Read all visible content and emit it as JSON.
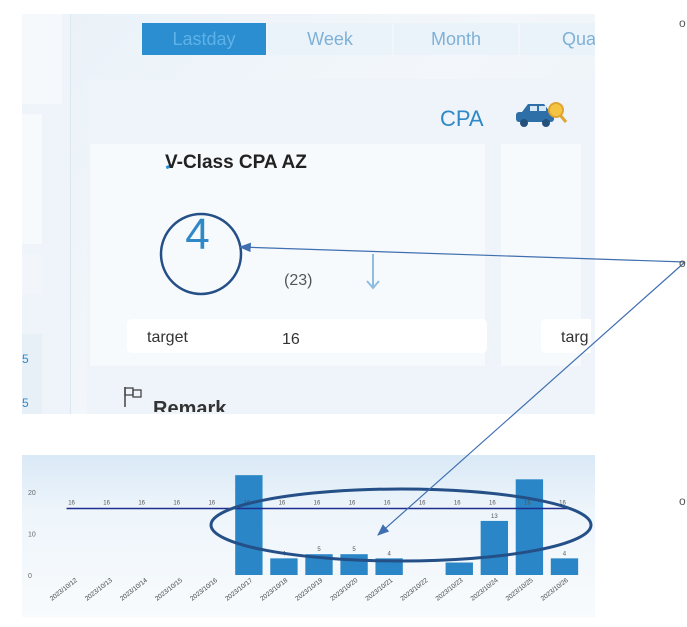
{
  "tabs": [
    "Lastday",
    "Week",
    "Month",
    "Quar"
  ],
  "active_tab": 0,
  "section_title": "CPA",
  "card": {
    "title": "V-Class CPA AZ",
    "value": "4",
    "comparison": "(23)",
    "target_label": "target",
    "target_value": "16",
    "second_card_target_label": "targ"
  },
  "remark_label": "Remark",
  "left_strip_marks": [
    "5",
    "5"
  ],
  "side_markers": [
    "o",
    "o",
    "o"
  ],
  "colors": {
    "accent": "#2f88c7",
    "tab_active": "#2b8ed0",
    "bar": "#2a86c6",
    "target_line": "#1f2f8f",
    "annotation": "#244f87"
  },
  "chart_data": {
    "type": "bar",
    "categories": [
      "2023/10/12",
      "2023/10/13",
      "2023/10/14",
      "2023/10/15",
      "2023/10/16",
      "2023/10/17",
      "2023/10/18",
      "2023/10/19",
      "2023/10/20",
      "2023/10/21",
      "2023/10/22",
      "2023/10/23",
      "2023/10/24",
      "2023/10/25",
      "2023/10/26"
    ],
    "series": [
      {
        "values": [
          0,
          0,
          0,
          0,
          0,
          24,
          4,
          5,
          5,
          4,
          0,
          3,
          13,
          23,
          4
        ]
      }
    ],
    "bar_labels": [
      "",
      "",
      "",
      "",
      "",
      "",
      "4",
      "5",
      "5",
      "4",
      "",
      "",
      "13",
      "",
      "4"
    ],
    "target": 16,
    "target_labels": [
      "16",
      "16",
      "16",
      "16",
      "16",
      "16",
      "16",
      "16",
      "16",
      "16",
      "16",
      "16",
      "16",
      "16",
      "16"
    ],
    "ylim": [
      0,
      25
    ],
    "yticks": [
      "0",
      "10",
      "20"
    ]
  }
}
